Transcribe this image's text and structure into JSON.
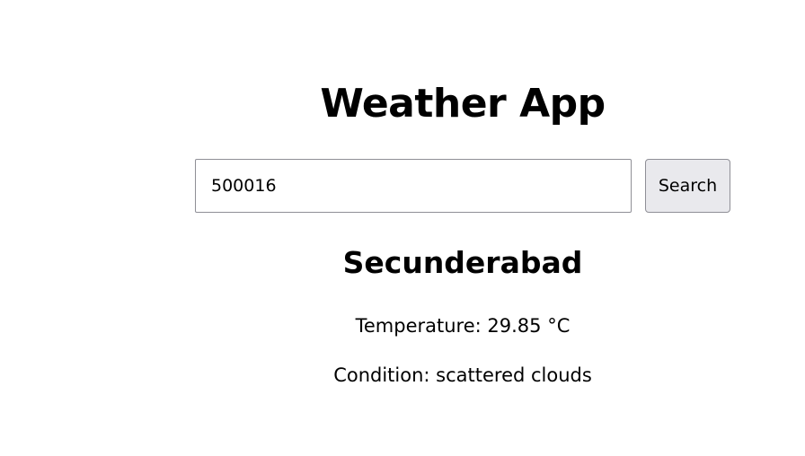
{
  "app": {
    "title": "Weather App"
  },
  "search": {
    "value": "500016",
    "button_label": "Search"
  },
  "result": {
    "city": "Secunderabad",
    "temperature": "Temperature: 29.85 °C",
    "condition": "Condition: scattered clouds"
  }
}
